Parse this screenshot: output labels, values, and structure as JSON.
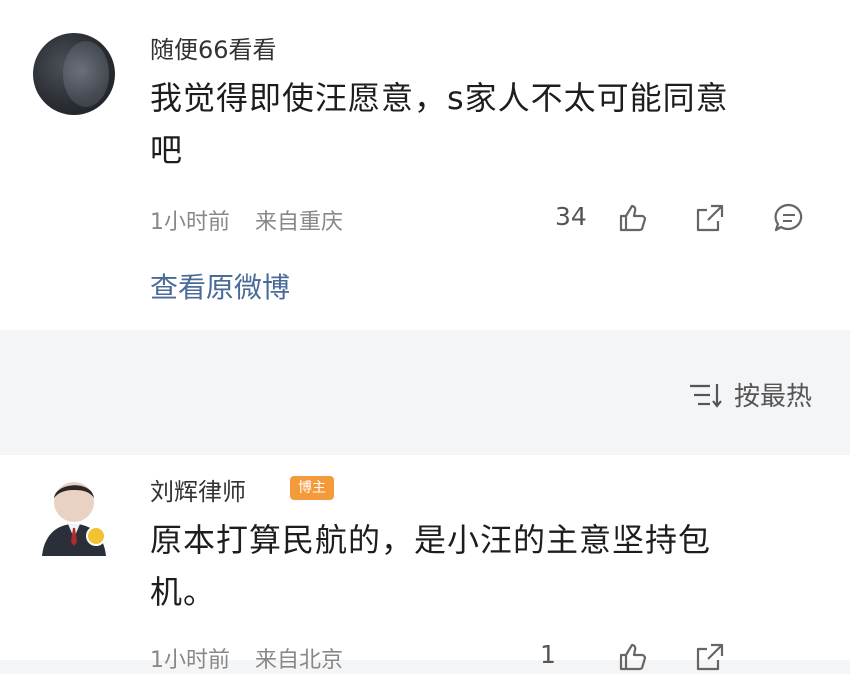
{
  "comment1": {
    "username": "随便66看看",
    "text_line1": "我觉得即使汪愿意，s家人不太可能同意",
    "text_line2": "吧",
    "time": "1小时前",
    "location": "来自重庆",
    "like_count": "34",
    "view_original": "查看原微博"
  },
  "sort": {
    "label": "按最热"
  },
  "comment2": {
    "username": "刘辉律师",
    "badge": "博主",
    "text_line1": "原本打算民航的，是小汪的主意坚持包",
    "text_line2": "机。",
    "time": "1小时前",
    "location": "来自北京",
    "like_count": "1"
  },
  "colors": {
    "link": "#4a6a99",
    "badge": "#f59a3a",
    "meta_text": "#888888"
  }
}
